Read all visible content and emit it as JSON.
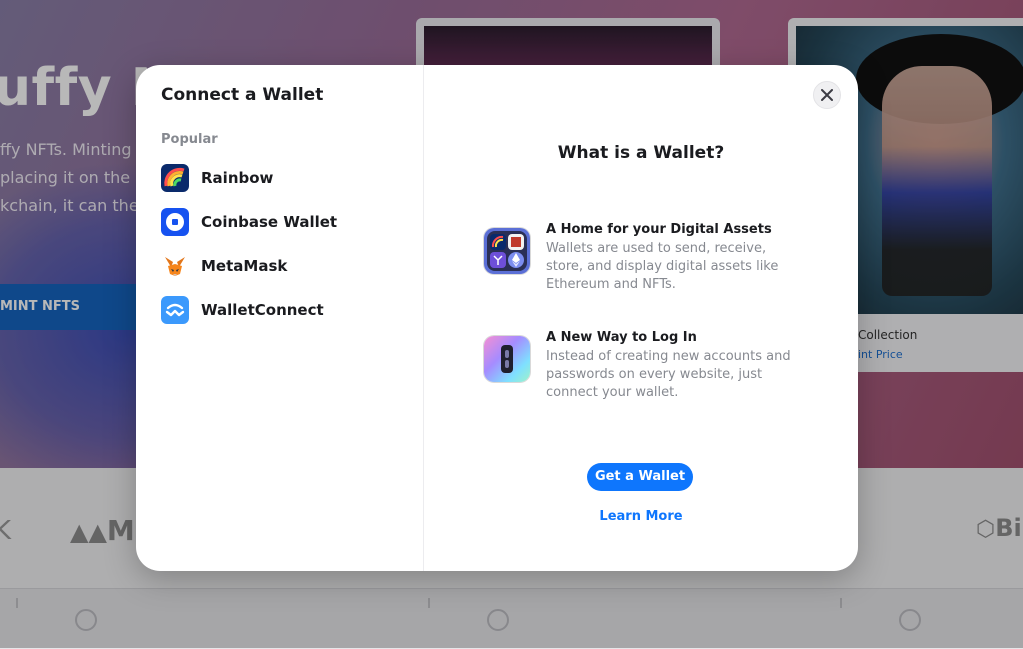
{
  "background": {
    "hero_title": "uffy NFTs",
    "hero_lines": [
      "ffy NFTs. Minting i",
      "placing it on the blo",
      "kchain, it can then"
    ],
    "mint_button": "MINT NFTS",
    "card2_title": "Collection",
    "card2_sub": "int Price",
    "partner_m": "M",
    "partner_bi": "Bi"
  },
  "modal": {
    "title": "Connect a Wallet",
    "section_label": "Popular",
    "wallets": [
      {
        "label": "Rainbow",
        "icon": "rainbow-icon"
      },
      {
        "label": "Coinbase Wallet",
        "icon": "coinbase-icon"
      },
      {
        "label": "MetaMask",
        "icon": "metamask-fox-icon"
      },
      {
        "label": "WalletConnect",
        "icon": "walletconnect-icon"
      }
    ],
    "close_icon": "close-icon",
    "right_title": "What is a Wallet?",
    "info": [
      {
        "title": "A Home for your Digital Assets",
        "desc": "Wallets are used to send, receive, store, and display digital assets like Ethereum and NFTs.",
        "icon": "digital-assets-icon"
      },
      {
        "title": "A New Way to Log In",
        "desc": "Instead of creating new accounts and passwords on every website, just connect your wallet.",
        "icon": "login-key-icon"
      }
    ],
    "get_wallet": "Get a Wallet",
    "learn_more": "Learn More"
  },
  "colors": {
    "accent": "#0e76fd",
    "text": "#1a1b1f",
    "muted": "#868990"
  }
}
